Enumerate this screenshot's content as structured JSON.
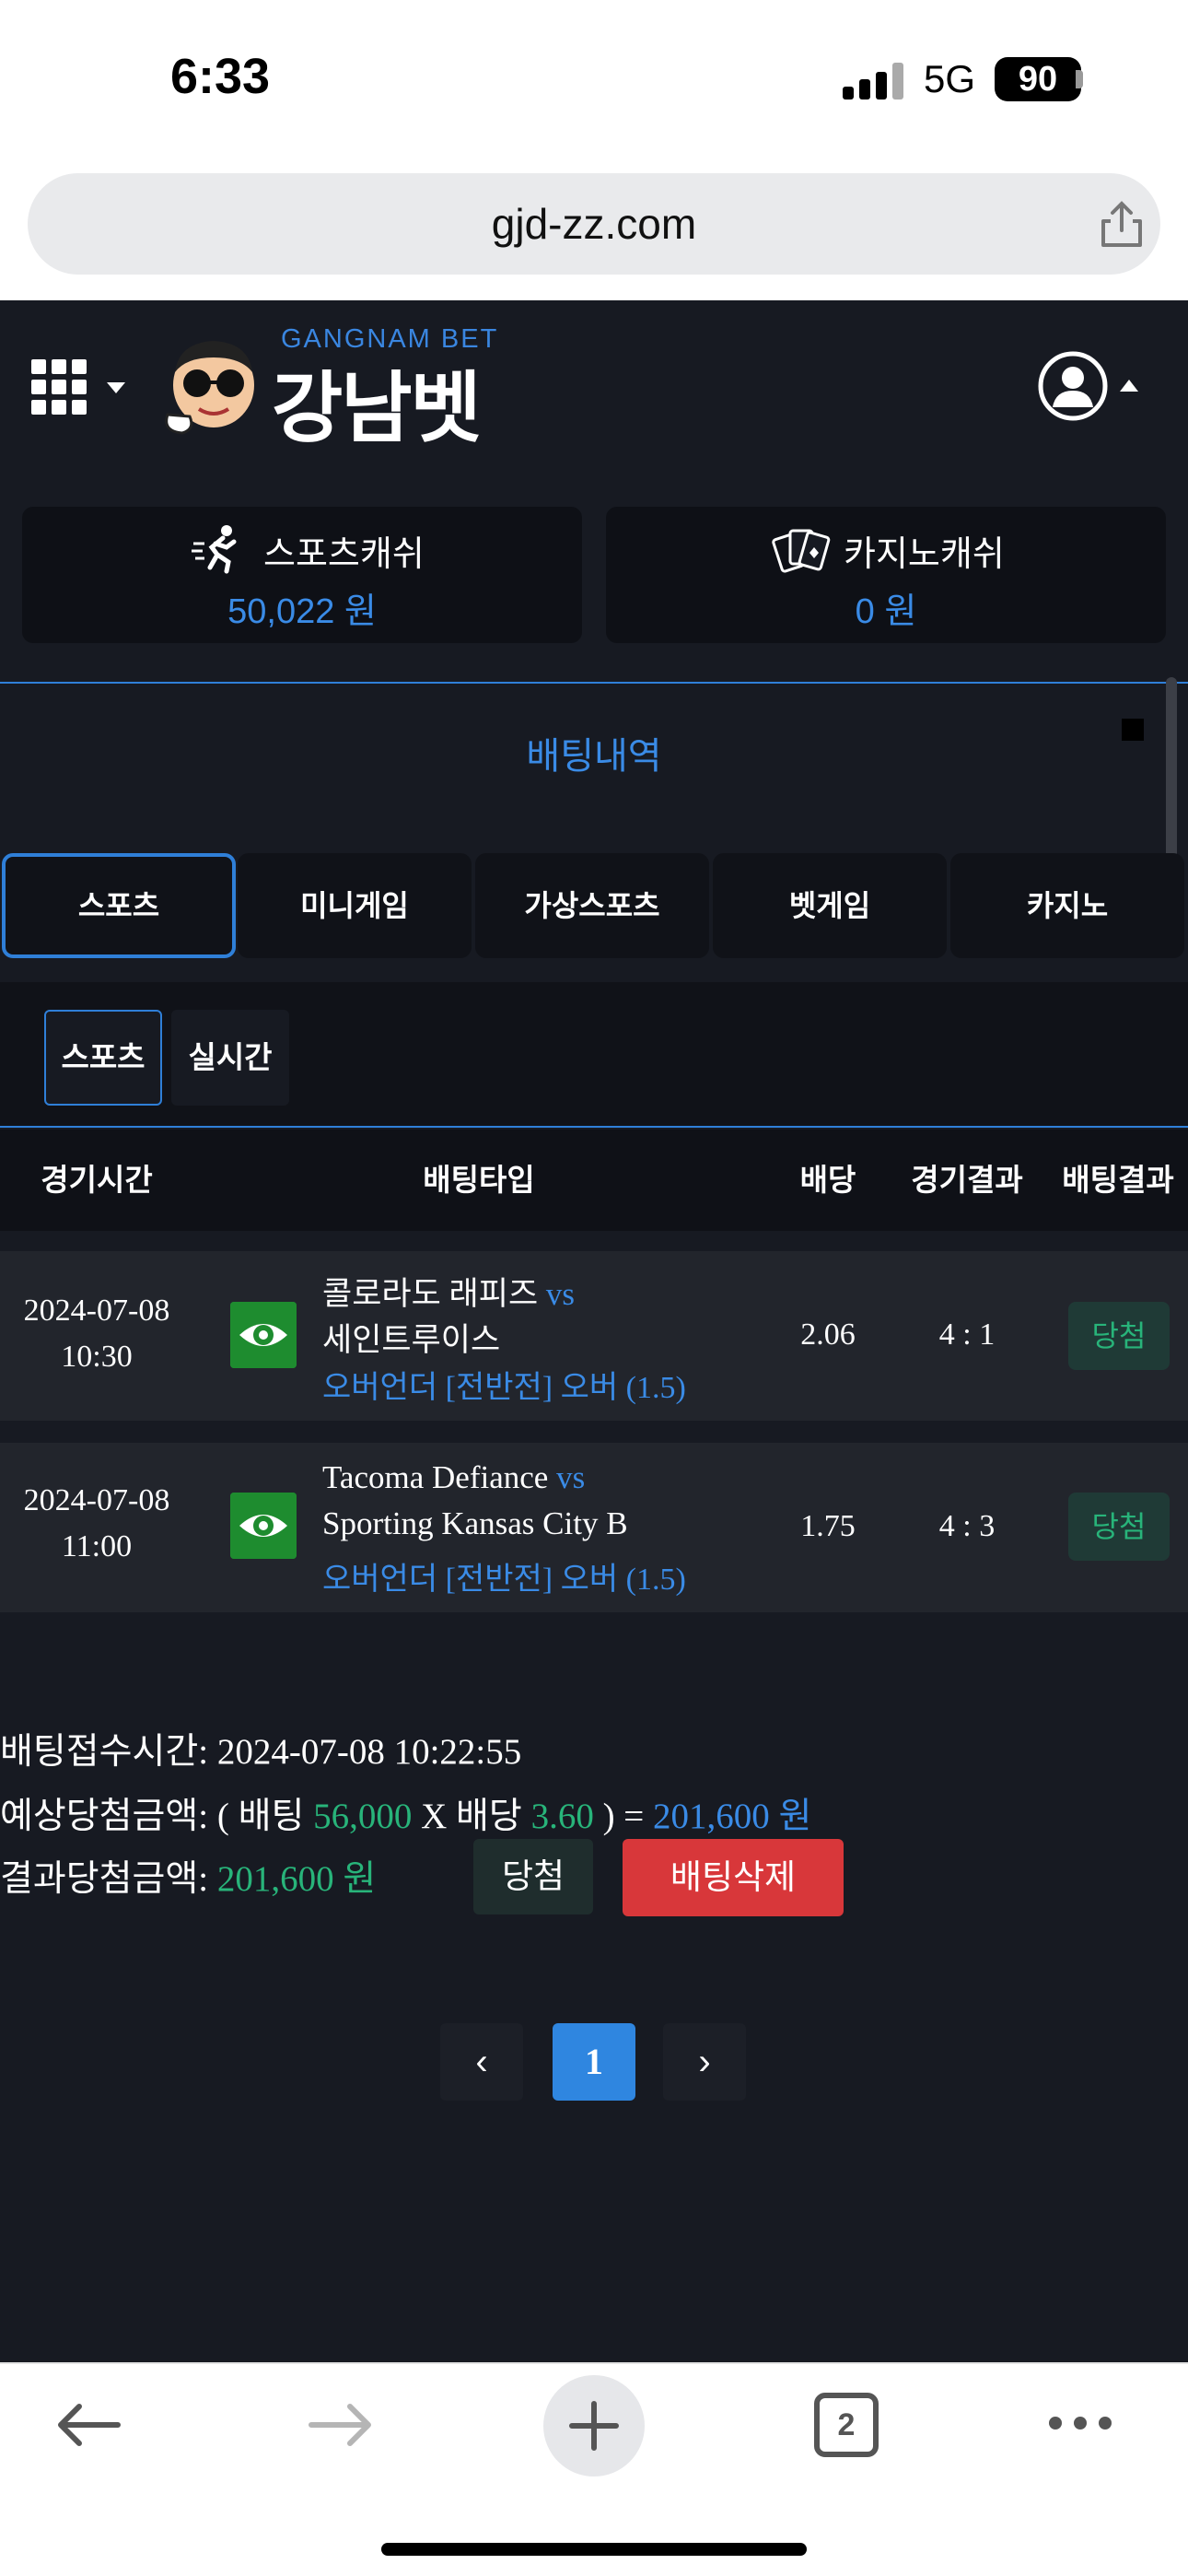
{
  "status_bar": {
    "time": "6:33",
    "network": "5G",
    "battery": "90"
  },
  "browser": {
    "url": "gjd-zz.com",
    "tab_count": "2"
  },
  "logo": {
    "subtitle": "GANGNAM BET",
    "title": "강남벳"
  },
  "wallet": {
    "sports": {
      "label": "스포츠캐쉬",
      "value": "50,022 원"
    },
    "casino": {
      "label": "카지노캐쉬",
      "value": "0 원"
    }
  },
  "section_title": "배팅내역",
  "tabs": [
    "스포츠",
    "미니게임",
    "가상스포츠",
    "벳게임",
    "카지노"
  ],
  "subtabs": [
    "스포츠",
    "실시간"
  ],
  "table": {
    "headers": [
      "경기시간",
      "배팅타입",
      "배당",
      "경기결과",
      "배팅결과"
    ],
    "rows": [
      {
        "date": "2024-07-08",
        "time": "10:30",
        "home": "콜로라도 래피즈",
        "vs": "vs",
        "away": "세인트루이스",
        "bet_type": "오버언더 [전반전] 오버 (1.5)",
        "odds": "2.06",
        "score": "4 : 1",
        "result": "당첨"
      },
      {
        "date": "2024-07-08",
        "time": "11:00",
        "home": "Tacoma Defiance",
        "vs": "vs",
        "away": "Sporting Kansas City B",
        "bet_type": "오버언더 [전반전] 오버 (1.5)",
        "odds": "1.75",
        "score": "4 : 3",
        "result": "당첨"
      }
    ]
  },
  "summary": {
    "accept_label": "배팅접수시간:",
    "accept_time": "2024-07-08 10:22:55",
    "expected_label": "예상당첨금액:",
    "open_paren": "( 배팅",
    "bet_amount": "56,000",
    "times": "X 배당",
    "total_odds": "3.60",
    "close_eq": ") =",
    "expected_amount": "201,600 원",
    "result_label": "결과당첨금액:",
    "result_amount": "201,600 원",
    "win_button": "당첨",
    "delete_button": "배팅삭제"
  },
  "pagination": {
    "prev": "‹",
    "current": "1",
    "next": "›"
  },
  "colors": {
    "accent": "#2f7fd8",
    "win": "#28b47a",
    "delete": "#d8373a",
    "background": "#171a22"
  }
}
